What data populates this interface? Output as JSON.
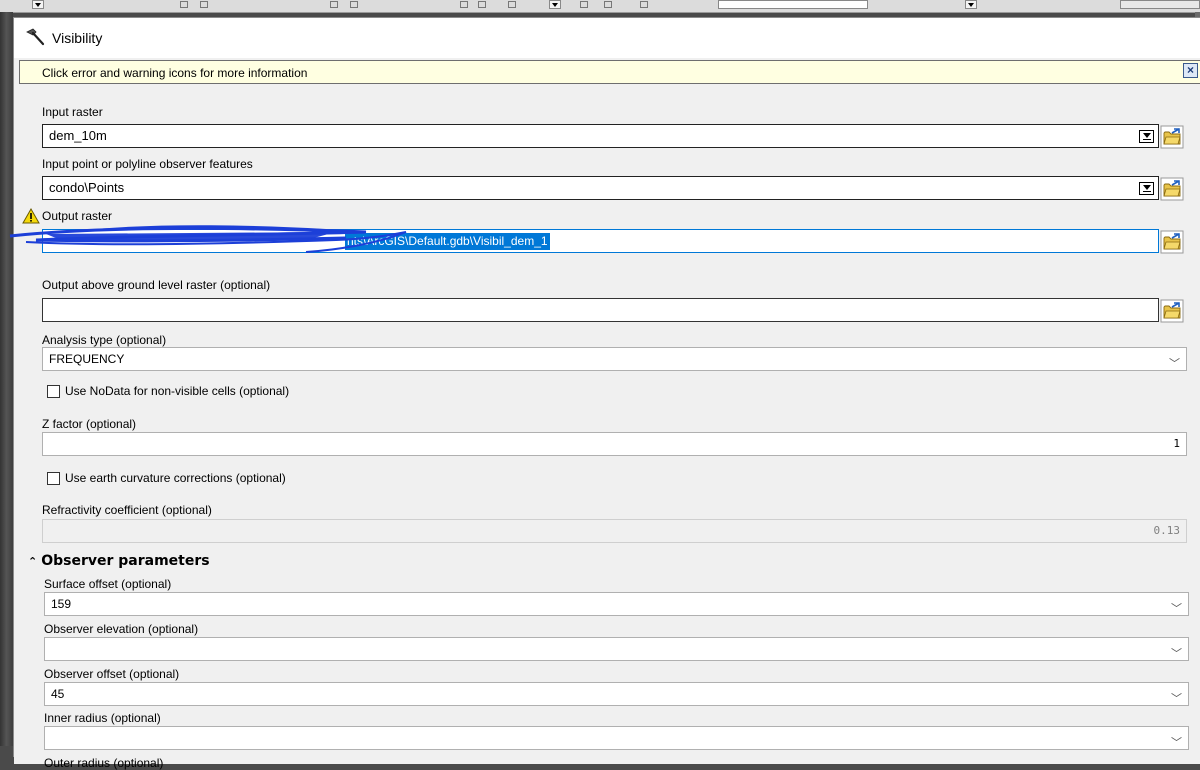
{
  "window": {
    "title": "Visibility"
  },
  "message_bar": {
    "text": "Click error and warning icons for more information",
    "close": "×"
  },
  "fields": {
    "input_raster": {
      "label": "Input raster",
      "value": "dem_10m"
    },
    "observer_features": {
      "label": "Input point or polyline observer features",
      "value": "condo\\Points"
    },
    "output_raster": {
      "label": "Output raster",
      "value_visible": "nts\\ArcGIS\\Default.gdb\\Visibil_dem_1",
      "has_warning": true
    },
    "agl_raster": {
      "label": "Output above ground level raster (optional)",
      "value": ""
    },
    "analysis_type": {
      "label": "Analysis type (optional)",
      "value": "FREQUENCY"
    },
    "use_nodata": {
      "label": "Use NoData for non-visible cells (optional)",
      "checked": false
    },
    "z_factor": {
      "label": "Z factor (optional)",
      "value": "1"
    },
    "earth_curvature": {
      "label": "Use earth curvature corrections (optional)",
      "checked": false
    },
    "refractivity": {
      "label": "Refractivity coefficient (optional)",
      "value": "0.13",
      "disabled": true
    }
  },
  "observer_section": {
    "title": "Observer parameters",
    "collapse_icon": "chevron-double-up-icon",
    "surface_offset": {
      "label": "Surface offset (optional)",
      "value": "159"
    },
    "observer_elevation": {
      "label": "Observer elevation (optional)",
      "value": ""
    },
    "observer_offset": {
      "label": "Observer offset (optional)",
      "value": "45"
    },
    "inner_radius": {
      "label": "Inner radius (optional)",
      "value": ""
    },
    "outer_radius": {
      "label": "Outer radius (optional)"
    }
  },
  "colors": {
    "warning": "#f5d90a",
    "message_bg": "#ffffe1",
    "selection": "#0078d7",
    "folder": "#e8c44a"
  }
}
